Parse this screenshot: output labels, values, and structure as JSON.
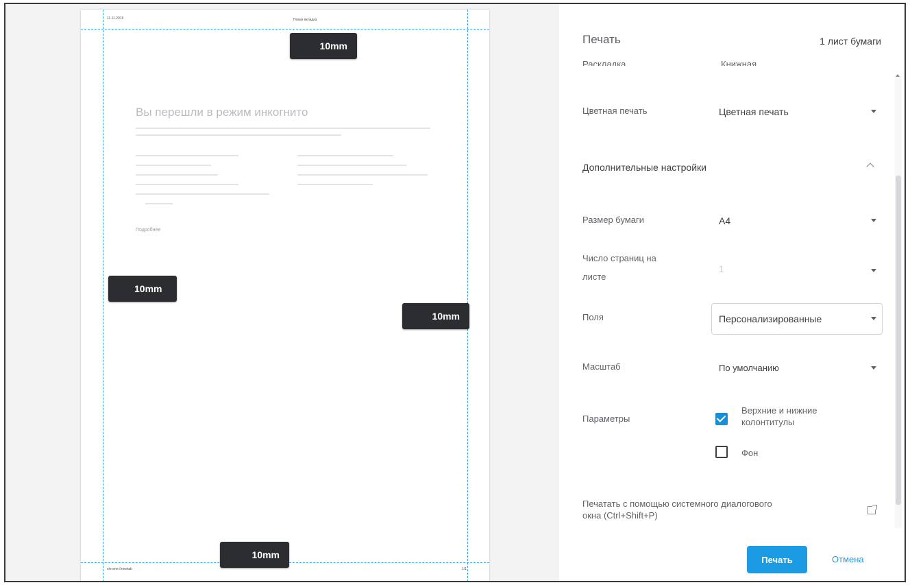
{
  "preview": {
    "header_date": "11.11.2019",
    "header_title": "Новая вкладка",
    "footer_url": "chrome://newtab",
    "footer_page": "1/1",
    "incognito_title": "Вы перешли в режим инкогнито",
    "incognito_link": "Подробнее",
    "margin_top": "10mm",
    "margin_left": "10mm",
    "margin_right": "10mm",
    "margin_bottom": "10mm"
  },
  "panel": {
    "title": "Печать",
    "sheets": "1 лист бумаги",
    "cut_label": "Раскладка",
    "cut_value": "Книжная",
    "color": {
      "label": "Цветная печать",
      "value": "Цветная печать"
    },
    "advanced_label": "Дополнительные настройки",
    "paper_size": {
      "label": "Размер бумаги",
      "value": "A4"
    },
    "pages_per_sheet": {
      "label_line1": "Число страниц на",
      "label_line2": "листе",
      "value": "1"
    },
    "margins": {
      "label": "Поля",
      "value": "Персонализированные"
    },
    "scale": {
      "label": "Масштаб",
      "value": "По умолчанию"
    },
    "options": {
      "label": "Параметры",
      "headers_footers_line1": "Верхние и нижние",
      "headers_footers_line2": "колонтитулы",
      "headers_footers_checked": true,
      "background": "Фон",
      "background_checked": false
    },
    "system_dialog_line1": "Печатать с помощью системного диалогового",
    "system_dialog_line2": "окна (Ctrl+Shift+P)",
    "print_button": "Печать",
    "cancel_button": "Отмена"
  }
}
